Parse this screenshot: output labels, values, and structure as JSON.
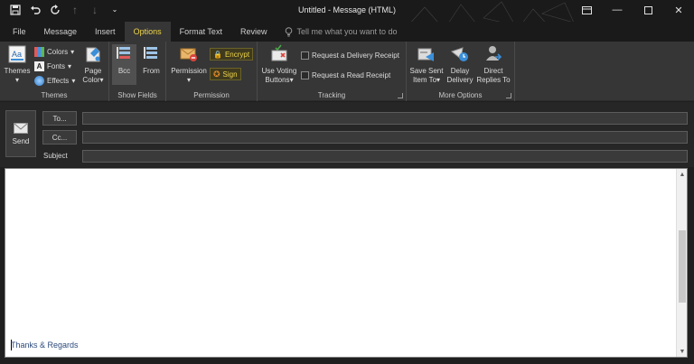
{
  "window": {
    "title": "Untitled  -  Message (HTML)"
  },
  "quick_access": {
    "icons": [
      "save-icon",
      "undo-icon",
      "redo-icon",
      "up-icon",
      "down-icon",
      "customize-icon"
    ]
  },
  "tabs": [
    {
      "label": "File"
    },
    {
      "label": "Message"
    },
    {
      "label": "Insert"
    },
    {
      "label": "Options"
    },
    {
      "label": "Format Text"
    },
    {
      "label": "Review"
    }
  ],
  "tell_me": {
    "placeholder": "Tell me what you want to do"
  },
  "ribbon": {
    "themes_group": {
      "label": "Themes",
      "themes": "Themes",
      "colors": "Colors",
      "fonts": "Fonts",
      "effects": "Effects",
      "page_color_1": "Page",
      "page_color_2": "Color"
    },
    "show_fields_group": {
      "label": "Show Fields",
      "bcc": "Bcc",
      "from": "From"
    },
    "permission_group": {
      "label": "Permission",
      "permission": "Permission",
      "encrypt": "Encrypt",
      "sign": "Sign"
    },
    "tracking_group": {
      "label": "Tracking",
      "voting_1": "Use Voting",
      "voting_2": "Buttons",
      "delivery_receipt": "Request a Delivery Receipt",
      "read_receipt": "Request a Read Receipt"
    },
    "more_options_group": {
      "label": "More Options",
      "save_sent_1": "Save Sent",
      "save_sent_2": "Item To",
      "delay_1": "Delay",
      "delay_2": "Delivery",
      "direct_1": "Direct",
      "direct_2": "Replies To"
    }
  },
  "compose": {
    "send": "Send",
    "to": "To...",
    "cc": "Cc...",
    "subject": "Subject",
    "to_value": "",
    "cc_value": "",
    "subject_value": ""
  },
  "body": {
    "signature": "Thanks & Regards"
  },
  "colors": {
    "accent": "#f0d64a",
    "background": "#1f1f1f",
    "ribbon": "#363636"
  }
}
